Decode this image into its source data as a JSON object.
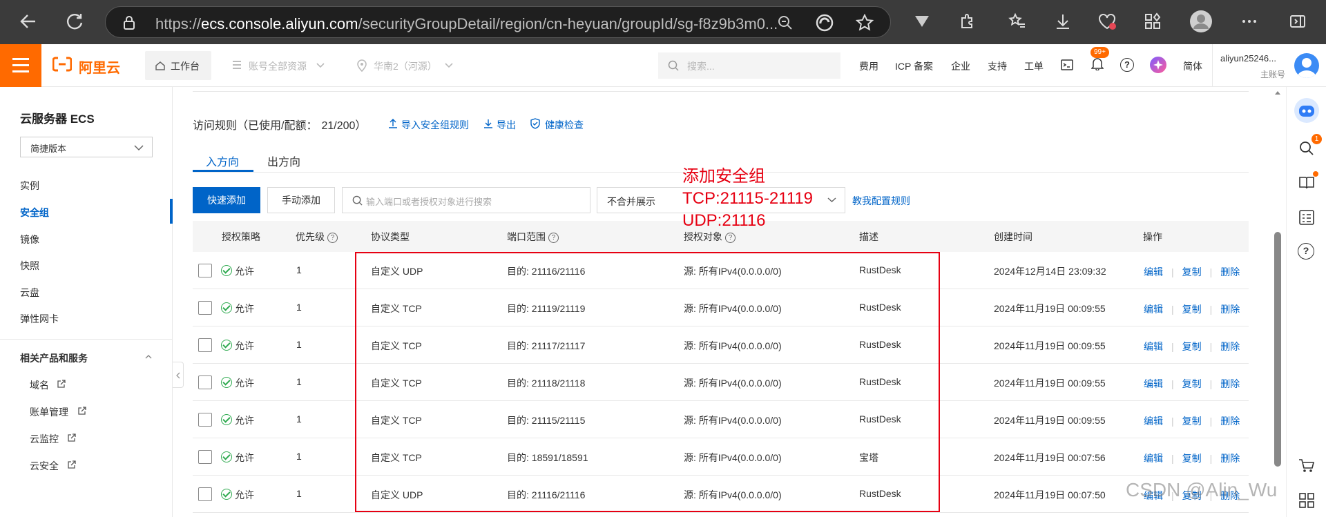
{
  "browser": {
    "url_prefix": "https://",
    "url_host": "ecs.console.aliyun.com",
    "url_path": "/securityGroupDetail/region/cn-heyuan/groupId/sg-f8z9b3m0..."
  },
  "header": {
    "logo_text": "阿里云",
    "workbench": "工作台",
    "account_resources": "账号全部资源",
    "region": "华南2（河源）",
    "search_placeholder": "搜索...",
    "nav": [
      "费用",
      "ICP 备案",
      "企业",
      "支持",
      "工单"
    ],
    "notification_badge": "99+",
    "language": "简体",
    "username": "aliyun25246...",
    "account_type": "主账号"
  },
  "sidebar": {
    "title": "云服务器 ECS",
    "version_select": "简捷版本",
    "items": [
      "实例",
      "安全组",
      "镜像",
      "快照",
      "云盘",
      "弹性网卡"
    ],
    "related_title": "相关产品和服务",
    "related_items": [
      "域名",
      "账单管理",
      "云监控",
      "云安全"
    ]
  },
  "main": {
    "rules_title": "访问规则（已使用/配额：",
    "quota": "21/200）",
    "import_rules": "导入安全组规则",
    "export": "导出",
    "health_check": "健康检查",
    "tab_inbound": "入方向",
    "tab_outbound": "出方向",
    "quick_add": "快速添加",
    "manual_add": "手动添加",
    "search_placeholder": "输入端口或者授权对象进行搜索",
    "merge_select": "不合并展示",
    "teach_link": "教我配置规则",
    "annotation_lines": [
      "添加安全组",
      "TCP:21115-21119",
      "UDP:21116"
    ],
    "columns": [
      "授权策略",
      "优先级",
      "协议类型",
      "端口范围",
      "授权对象",
      "描述",
      "创建时间",
      "操作"
    ],
    "actions": [
      "编辑",
      "复制",
      "删除"
    ],
    "rows": [
      {
        "policy": "允许",
        "priority": "1",
        "protocol": "自定义 UDP",
        "port": "目的: 21116/21116",
        "source": "源: 所有IPv4(0.0.0.0/0)",
        "desc": "RustDesk",
        "created": "2024年12月14日 23:09:32"
      },
      {
        "policy": "允许",
        "priority": "1",
        "protocol": "自定义 TCP",
        "port": "目的: 21119/21119",
        "source": "源: 所有IPv4(0.0.0.0/0)",
        "desc": "RustDesk",
        "created": "2024年11月19日 00:09:55"
      },
      {
        "policy": "允许",
        "priority": "1",
        "protocol": "自定义 TCP",
        "port": "目的: 21117/21117",
        "source": "源: 所有IPv4(0.0.0.0/0)",
        "desc": "RustDesk",
        "created": "2024年11月19日 00:09:55"
      },
      {
        "policy": "允许",
        "priority": "1",
        "protocol": "自定义 TCP",
        "port": "目的: 21118/21118",
        "source": "源: 所有IPv4(0.0.0.0/0)",
        "desc": "RustDesk",
        "created": "2024年11月19日 00:09:55"
      },
      {
        "policy": "允许",
        "priority": "1",
        "protocol": "自定义 TCP",
        "port": "目的: 21115/21115",
        "source": "源: 所有IPv4(0.0.0.0/0)",
        "desc": "RustDesk",
        "created": "2024年11月19日 00:09:55"
      },
      {
        "policy": "允许",
        "priority": "1",
        "protocol": "自定义 TCP",
        "port": "目的: 18591/18591",
        "source": "源: 所有IPv4(0.0.0.0/0)",
        "desc": "宝塔",
        "created": "2024年11月19日 00:07:56"
      },
      {
        "policy": "允许",
        "priority": "1",
        "protocol": "自定义 UDP",
        "port": "目的: 21116/21116",
        "source": "源: 所有IPv4(0.0.0.0/0)",
        "desc": "RustDesk",
        "created": "2024年11月19日 00:07:50"
      }
    ]
  },
  "rail": {
    "badge": "1"
  },
  "watermark": "CSDN @Alin_Wu",
  "colors": {
    "brand": "#ff6a00",
    "primary": "#0064c8",
    "annotation": "#e60012",
    "success": "#2eaa4f"
  }
}
